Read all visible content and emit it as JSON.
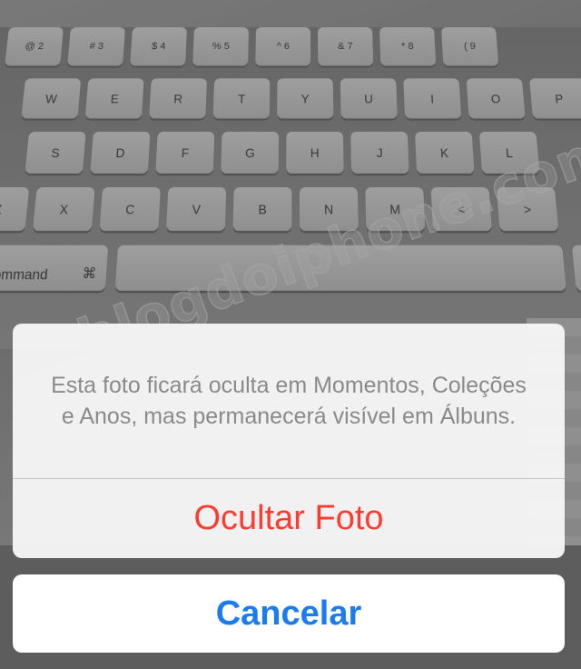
{
  "background": {
    "watermark": "blogdoiphone.com",
    "keyboard_rows": [
      [
        "@\n2",
        "#\n3",
        "$\n4",
        "%\n5",
        "^\n6",
        "&\n7",
        "*\n8",
        "(\n9"
      ],
      [
        "W",
        "E",
        "R",
        "T",
        "Y",
        "U",
        "I",
        "O",
        "P"
      ],
      [
        "S",
        "D",
        "F",
        "G",
        "H",
        "J",
        "K",
        "L"
      ],
      [
        "Z",
        "X",
        "C",
        "V",
        "B",
        "N",
        "M",
        "<",
        ">"
      ]
    ],
    "command_key": {
      "label": "command",
      "symbol": "⌘"
    }
  },
  "action_sheet": {
    "message": "Esta foto ficará oculta em Momentos, Coleções e Anos, mas permanecerá visível em Álbuns.",
    "destructive_action": "Ocultar Foto",
    "cancel_label": "Cancelar"
  },
  "colors": {
    "destructive": "#ff3b30",
    "cancel": "#1a7cf0"
  }
}
